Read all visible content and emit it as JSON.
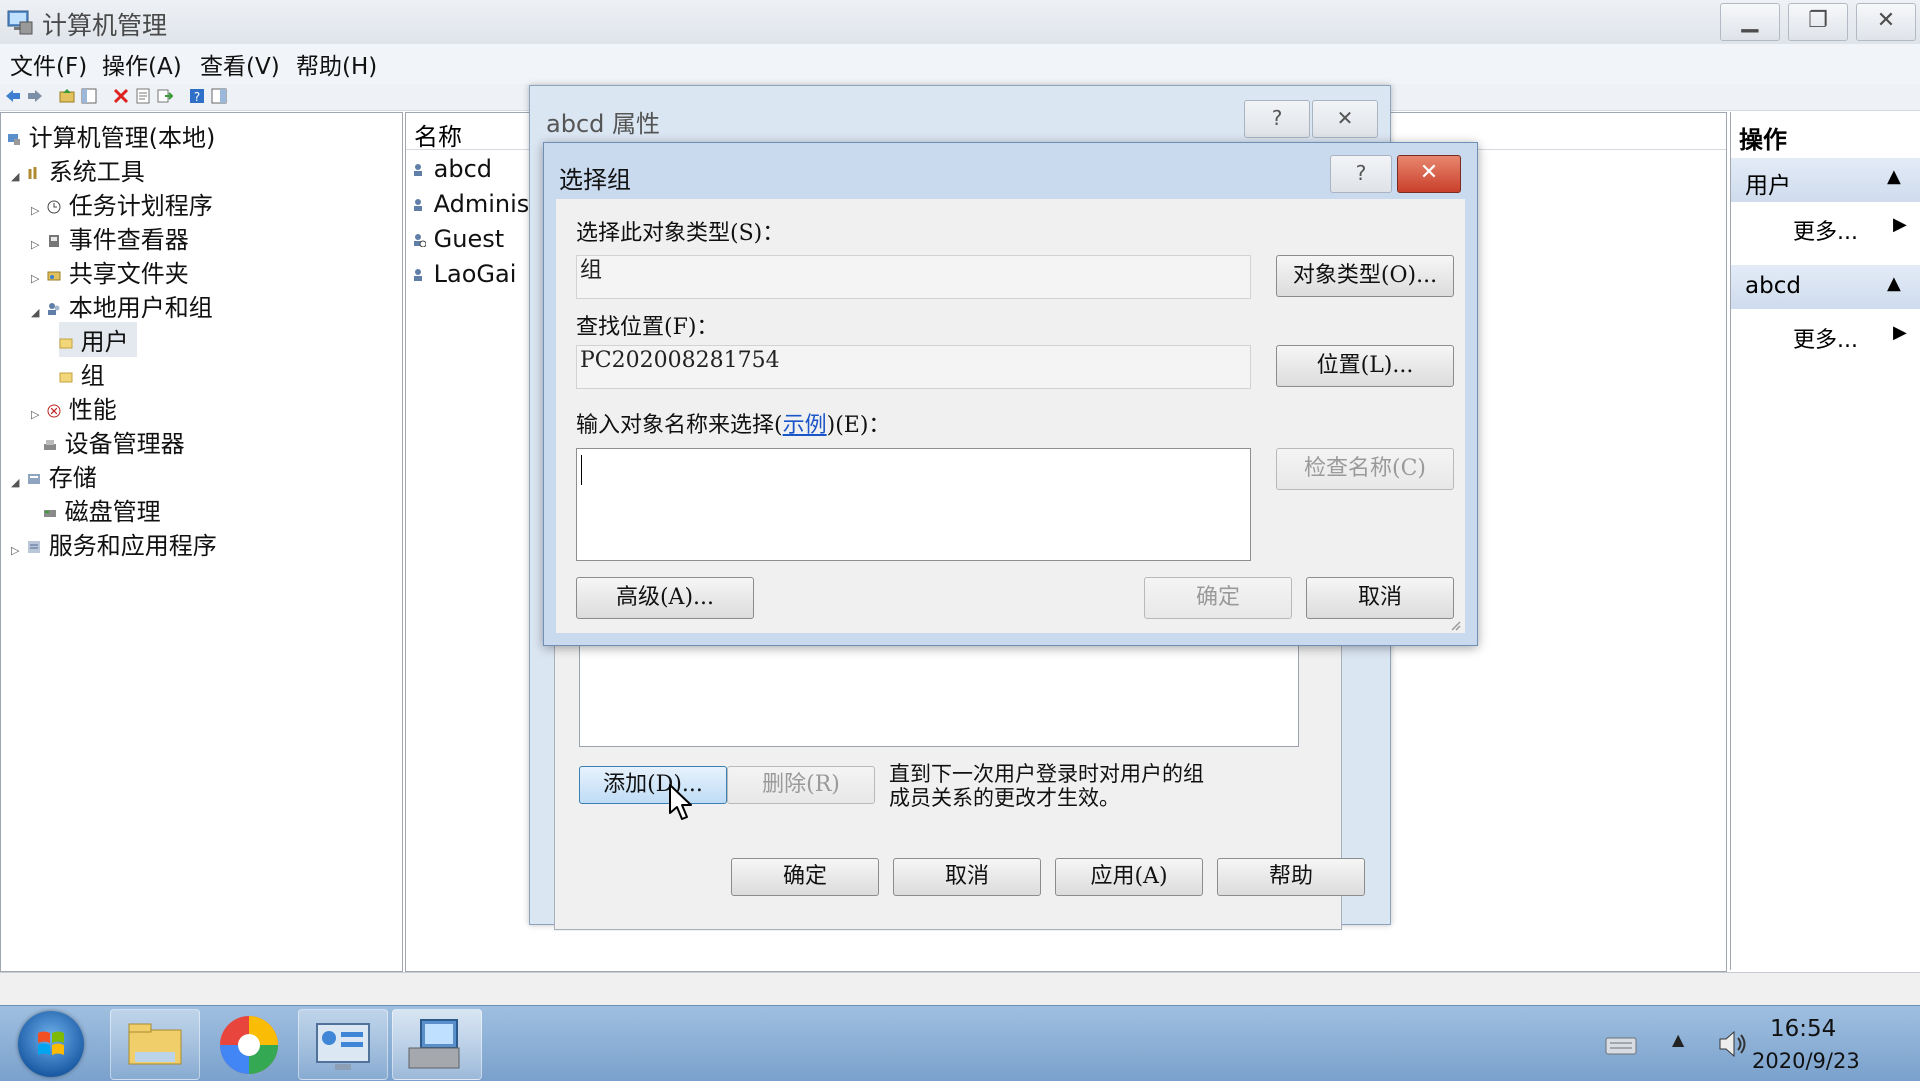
{
  "app": {
    "title": "计算机管理",
    "menus": [
      "文件(F)",
      "操作(A)",
      "查看(V)",
      "帮助(H)"
    ]
  },
  "tree": {
    "root": "计算机管理(本地)",
    "items": [
      {
        "label": "系统工具"
      },
      {
        "label": "任务计划程序"
      },
      {
        "label": "事件查看器"
      },
      {
        "label": "共享文件夹"
      },
      {
        "label": "本地用户和组"
      },
      {
        "label": "用户"
      },
      {
        "label": "组"
      },
      {
        "label": "性能"
      },
      {
        "label": "设备管理器"
      },
      {
        "label": "存储"
      },
      {
        "label": "磁盘管理"
      },
      {
        "label": "服务和应用程序"
      }
    ]
  },
  "list": {
    "column_name": "名称",
    "rows": [
      "abcd",
      "Administ",
      "Guest",
      "LaoGai"
    ]
  },
  "actions": {
    "title": "操作",
    "sections": [
      {
        "header": "用户",
        "more": "更多..."
      },
      {
        "header": "abcd",
        "more": "更多..."
      }
    ]
  },
  "props_dialog": {
    "title": "abcd 属性",
    "help": "?",
    "close": "✕",
    "add_button": "添加(D)...",
    "remove_button": "删除(R)",
    "note_line1": "直到下一次用户登录时对用户的组",
    "note_line2": "成员关系的更改才生效。",
    "ok": "确定",
    "cancel": "取消",
    "apply": "应用(A)",
    "help_button": "帮助"
  },
  "select_dialog": {
    "title": "选择组",
    "help": "?",
    "close": "✕",
    "object_type_label": "选择此对象类型(S)：",
    "object_type_value": "组",
    "object_type_button": "对象类型(O)...",
    "location_label": "查找位置(F)：",
    "location_value": "PC202008281754",
    "location_button": "位置(L)...",
    "enter_name_label_pre": "输入对象名称来选择(",
    "enter_name_link": "示例",
    "enter_name_label_post": ")(E)：",
    "name_value": "",
    "check_names_button": "检查名称(C)",
    "advanced_button": "高级(A)...",
    "ok": "确定",
    "cancel": "取消"
  },
  "taskbar": {
    "time": "16:54",
    "date": "2020/9/23"
  }
}
